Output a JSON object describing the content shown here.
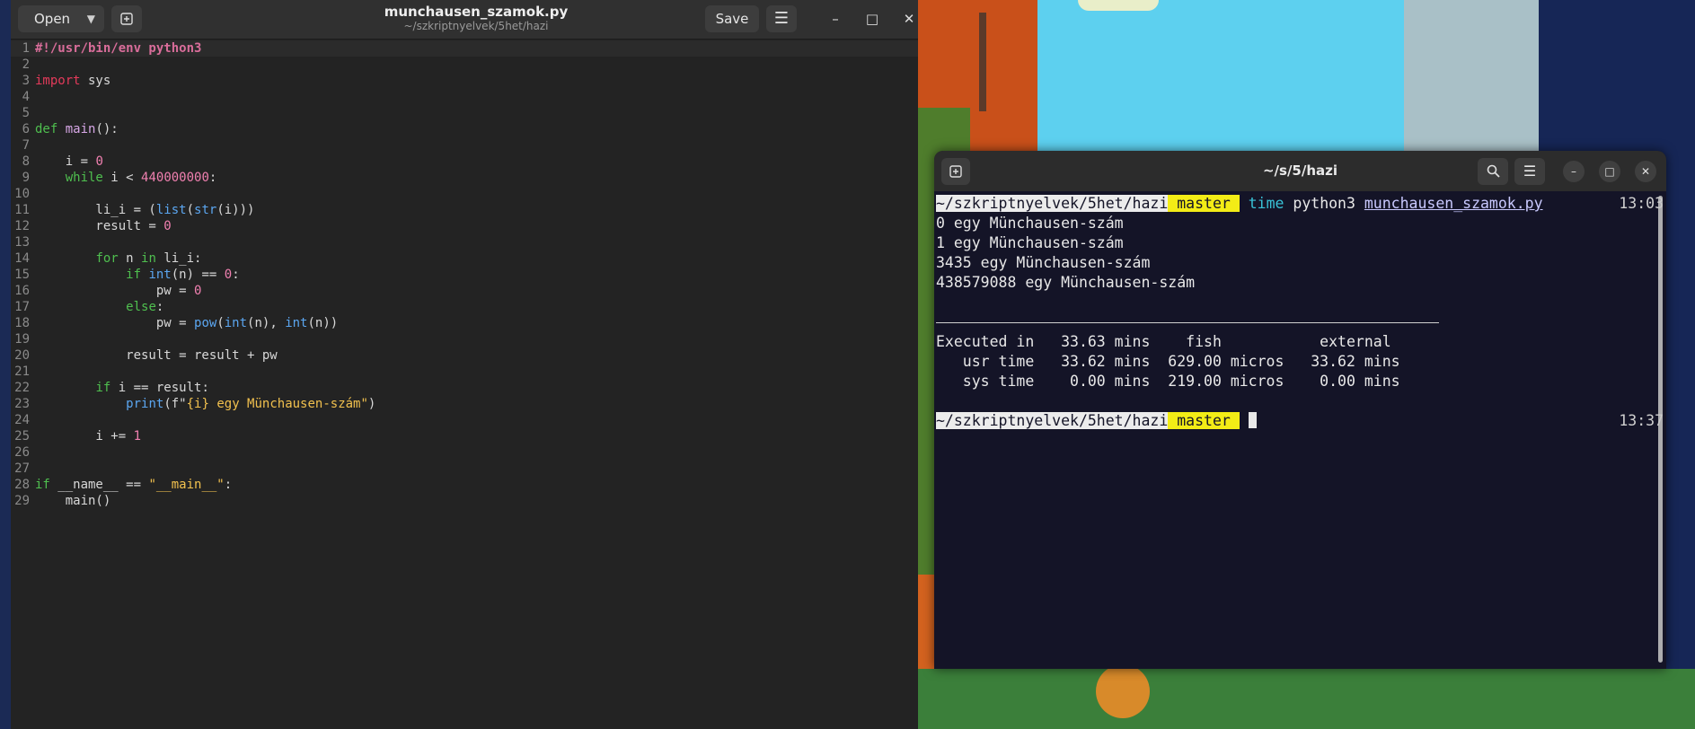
{
  "editor": {
    "title": "munchausen_szamok.py",
    "subtitle": "~/szkriptnyelvek/5het/hazi",
    "open_label": "Open",
    "save_label": "Save",
    "icons": {
      "new_tab": "new-tab-icon",
      "menu": "hamburger-menu-icon",
      "minimize": "minimize-icon",
      "maximize": "maximize-icon",
      "close": "close-icon"
    },
    "line_numbers": [
      "1",
      "2",
      "3",
      "4",
      "5",
      "6",
      "7",
      "8",
      "9",
      "10",
      "11",
      "12",
      "13",
      "14",
      "15",
      "16",
      "17",
      "18",
      "19",
      "20",
      "21",
      "22",
      "23",
      "24",
      "25",
      "26",
      "27",
      "28",
      "29"
    ],
    "code": {
      "l1": "#!/usr/bin/env python3",
      "l3a": "import",
      "l3b": " sys",
      "l6a": "def",
      "l6b": " ",
      "l6c": "main",
      "l6d": "():",
      "l8a": "    i = ",
      "l8b": "0",
      "l9a": "    ",
      "l9b": "while",
      "l9c": " i < ",
      "l9d": "440000000",
      "l9e": ":",
      "l11a": "        li_i = (",
      "l11b": "list",
      "l11c": "(",
      "l11d": "str",
      "l11e": "(i)))",
      "l12a": "        result = ",
      "l12b": "0",
      "l14a": "        ",
      "l14b": "for",
      "l14c": " n ",
      "l14d": "in",
      "l14e": " li_i:",
      "l15a": "            ",
      "l15b": "if",
      "l15c": " ",
      "l15d": "int",
      "l15e": "(n) == ",
      "l15f": "0",
      "l15g": ":",
      "l16a": "                pw = ",
      "l16b": "0",
      "l17a": "            ",
      "l17b": "else",
      "l17c": ":",
      "l18a": "                pw = ",
      "l18b": "pow",
      "l18c": "(",
      "l18d": "int",
      "l18e": "(n), ",
      "l18f": "int",
      "l18g": "(n))",
      "l20": "            result = result + pw",
      "l22a": "        ",
      "l22b": "if",
      "l22c": " i == result:",
      "l23a": "            ",
      "l23b": "print",
      "l23c": "(f\"",
      "l23d": "{i}",
      "l23e": " egy Münchausen-szám\"",
      "l23f": ")",
      "l25a": "        i += ",
      "l25b": "1",
      "l28a": "if",
      "l28b": " __name__ == ",
      "l28c": "\"__main__\"",
      "l28d": ":",
      "l29": "    main()"
    }
  },
  "terminal": {
    "title": "~/s/5/hazi",
    "icons": {
      "new_tab": "new-tab-icon",
      "search": "search-icon",
      "menu": "hamburger-menu-icon",
      "minimize": "minimize-icon",
      "maximize": "maximize-icon",
      "close": "close-icon"
    },
    "prompt_path": "~/szkriptnyelvek/5het/hazi",
    "prompt_branch": " master ",
    "cmd_keyword": "time",
    "cmd_rest": " python3 ",
    "cmd_file": "munchausen_szamok.py",
    "clock1": "13:03",
    "output": [
      "0 egy Münchausen-szám",
      "1 egy Münchausen-szám",
      "3435 egy Münchausen-szám",
      "438579088 egy Münchausen-szám"
    ],
    "timing": {
      "header": "Executed in   33.63 mins    fish           external",
      "usr": "   usr time   33.62 mins  629.00 micros   33.62 mins",
      "sys": "   sys time    0.00 mins  219.00 micros    0.00 mins"
    },
    "clock2": "13:37"
  }
}
